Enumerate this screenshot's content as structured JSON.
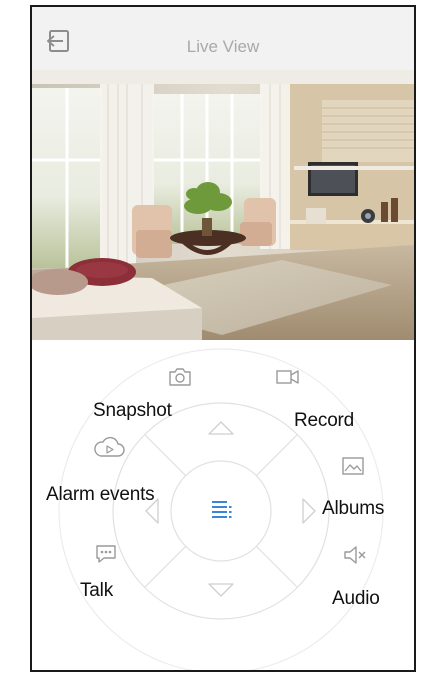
{
  "header": {
    "title": "Live View"
  },
  "controls": {
    "snapshot_label": "Snapshot",
    "record_label": "Record",
    "alarm_events_label": "Alarm events",
    "albums_label": "Albums",
    "talk_label": "Talk",
    "audio_label": "Audio"
  },
  "icons": {
    "back": "back-arrow-icon",
    "camera": "camera-icon",
    "video": "video-camera-icon",
    "cloud": "cloud-play-icon",
    "album": "image-icon",
    "chat": "chat-bubble-icon",
    "speaker": "speaker-mute-icon",
    "menu": "menu-list-icon"
  },
  "colors": {
    "accent": "#3a86d4",
    "header_bg": "#f2f2f2",
    "title": "#a9a9a9",
    "icon_gray": "#9a9a9a",
    "ring": "#e4e4e4"
  }
}
